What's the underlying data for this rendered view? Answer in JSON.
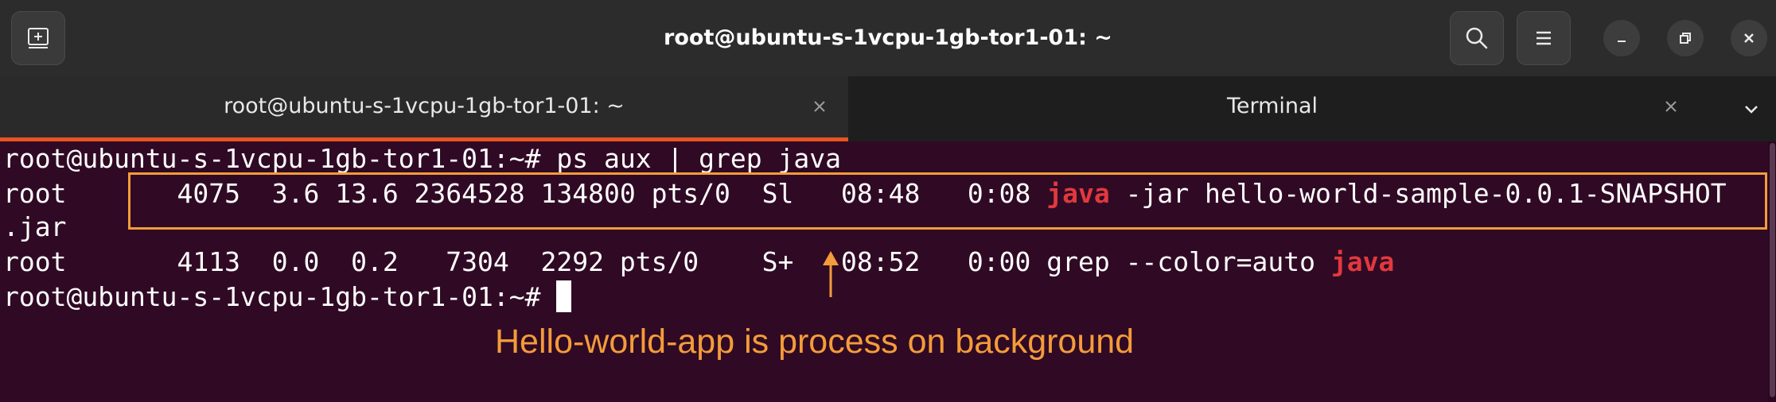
{
  "window": {
    "title": "root@ubuntu-s-1vcpu-1gb-tor1-01: ~",
    "buttons": {
      "new_tab_icon": "new-tab-icon",
      "search_icon": "search-icon",
      "menu_icon": "hamburger-menu-icon",
      "minimize_icon": "minimize-icon",
      "maximize_icon": "restore-icon",
      "close_icon": "close-icon"
    }
  },
  "tabs": [
    {
      "label": "root@ubuntu-s-1vcpu-1gb-tor1-01: ~",
      "active": true
    },
    {
      "label": "Terminal",
      "active": false
    }
  ],
  "terminal": {
    "lines": {
      "cmd": "root@ubuntu-s-1vcpu-1gb-tor1-01:~# ps aux | grep java",
      "row1_pre": "root       4075  3.6 13.6 2364528 134800 pts/0  Sl   08:48   0:08 ",
      "row1_match": "java",
      "row1_post": " -jar hello-world-sample-0.0.1-SNAPSHOT",
      "row1_wrap": ".jar",
      "row2_pre": "root       4113  0.0  0.2   7304  2292 pts/0    S+   08:52   0:00 grep --color=auto ",
      "row2_match": "java",
      "prompt": "root@ubuntu-s-1vcpu-1gb-tor1-01:~# "
    },
    "colors": {
      "background": "#300a24",
      "match": "#e0393e",
      "text": "#ffffff"
    }
  },
  "annotation": {
    "text": "Hello-world-app is process on background",
    "color": "#f39c3a"
  }
}
